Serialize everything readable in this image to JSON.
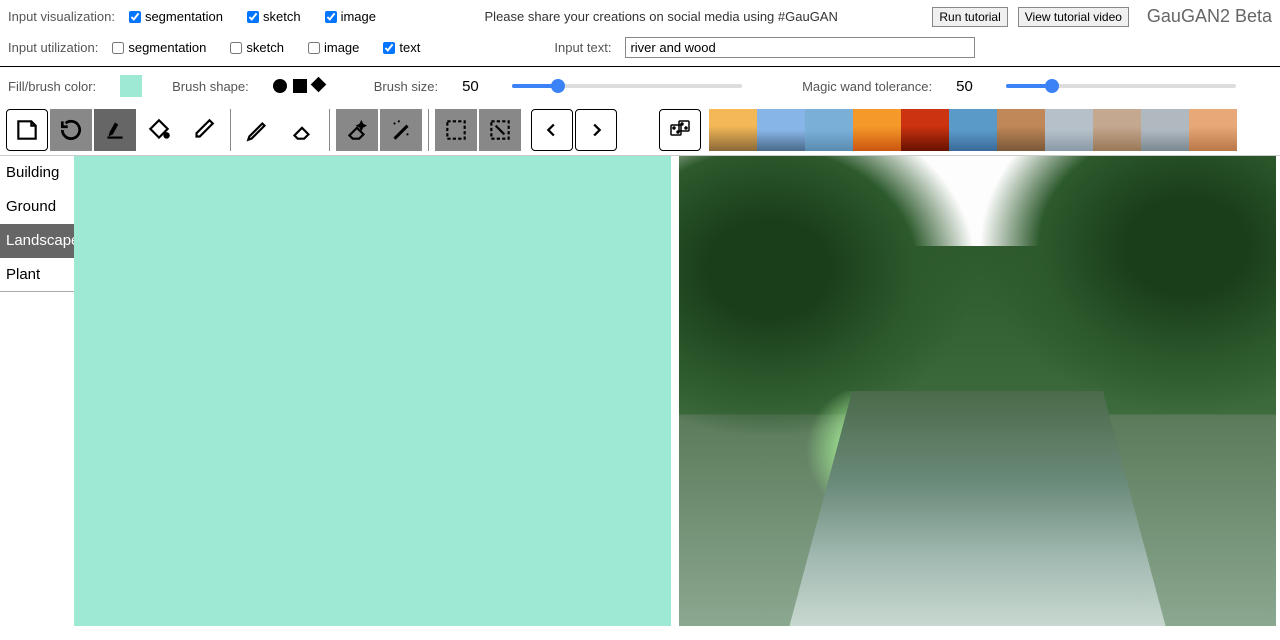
{
  "top": {
    "vis_label": "Input visualization:",
    "vis": [
      {
        "label": "segmentation",
        "checked": true
      },
      {
        "label": "sketch",
        "checked": true
      },
      {
        "label": "image",
        "checked": true
      }
    ],
    "promo": "Please share your creations on social media using #GauGAN",
    "btn_tutorial": "Run tutorial",
    "btn_video": "View tutorial video",
    "app_title": "GauGAN2 Beta"
  },
  "row2": {
    "util_label": "Input utilization:",
    "util": [
      {
        "label": "segmentation",
        "checked": false
      },
      {
        "label": "sketch",
        "checked": false
      },
      {
        "label": "image",
        "checked": false
      },
      {
        "label": "text",
        "checked": true
      }
    ],
    "text_label": "Input text:",
    "text_value": "river and wood"
  },
  "settings": {
    "fill_label": "Fill/brush color:",
    "fill_color": "#9de9d4",
    "shape_label": "Brush shape:",
    "size_label": "Brush size:",
    "size_value": "50",
    "wand_label": "Magic wand tolerance:",
    "wand_value": "50"
  },
  "categories": [
    "Building",
    "Ground",
    "Landscape",
    "Plant"
  ],
  "selected_category": "Landscape",
  "thumbs": [
    "#fefefe",
    "#f5b857",
    "#88b5e8",
    "#7ab0d8",
    "#f59a2a",
    "#cc3311",
    "#5a9ac8",
    "#c08858",
    "#b5c0c8",
    "#c5a890",
    "#b0b8c0",
    "#e8a878"
  ]
}
